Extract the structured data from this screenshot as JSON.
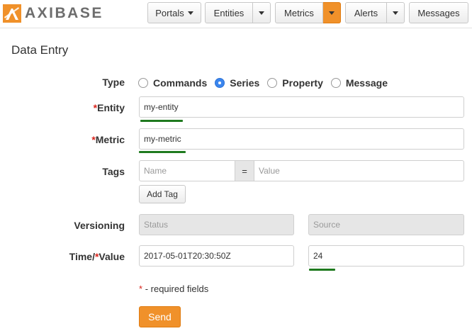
{
  "logo": {
    "text": "AXIBASE",
    "icon": "axibase-logo-icon"
  },
  "nav": {
    "portals": "Portals",
    "entities": "Entities",
    "metrics": "Metrics",
    "alerts": "Alerts",
    "messages": "Messages"
  },
  "page": {
    "title": "Data Entry"
  },
  "form": {
    "type_label": "Type",
    "type_options": [
      "Commands",
      "Series",
      "Property",
      "Message"
    ],
    "type_selected": "Series",
    "entity_label": "Entity",
    "entity_value": "my-entity",
    "metric_label": "Metric",
    "metric_value": "my-metric",
    "tags_label": "Tags",
    "tag_name_placeholder": "Name",
    "tag_equals": "=",
    "tag_value_placeholder": "Value",
    "add_tag_label": "Add Tag",
    "versioning_label": "Versioning",
    "status_placeholder": "Status",
    "source_placeholder": "Source",
    "time_label_prefix": "Time/",
    "value_label": "Value",
    "time_value": "2017-05-01T20:30:50Z",
    "value_value": "24",
    "required_marker": "*",
    "required_note": "- required fields",
    "send_label": "Send"
  },
  "colors": {
    "accent": "#f0912a",
    "required": "#d9251c",
    "radio_checked": "#3b86ee",
    "underline": "#1f7a1f"
  }
}
